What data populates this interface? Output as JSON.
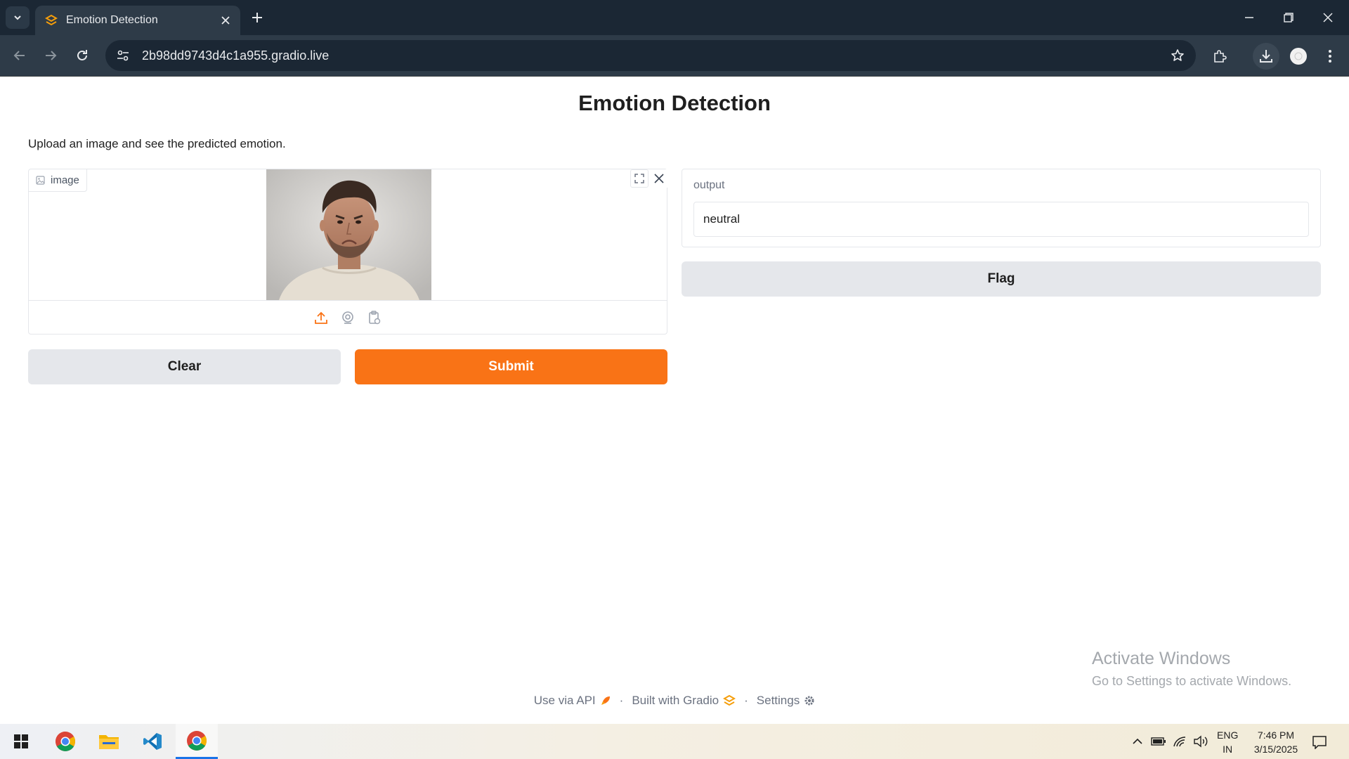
{
  "browser": {
    "tab_title": "Emotion Detection",
    "url": "2b98dd9743d4c1a955.gradio.live"
  },
  "app": {
    "title": "Emotion Detection",
    "description": "Upload an image and see the predicted emotion.",
    "input": {
      "label": "image",
      "sources": [
        "upload-icon",
        "webcam-icon",
        "clipboard-icon"
      ]
    },
    "buttons": {
      "clear": "Clear",
      "submit": "Submit",
      "flag": "Flag"
    },
    "output": {
      "label": "output",
      "value": "neutral"
    },
    "accent_color": "#f97316"
  },
  "footer": {
    "api": "Use via API",
    "built_with": "Built with Gradio",
    "settings": "Settings"
  },
  "watermark": {
    "title": "Activate Windows",
    "subtitle": "Go to Settings to activate Windows."
  },
  "taskbar": {
    "apps": [
      "windows-start-icon",
      "chrome-icon",
      "file-explorer-icon",
      "vscode-icon",
      "chrome-active-icon"
    ],
    "lang_line1": "ENG",
    "lang_line2": "IN",
    "time": "7:46 PM",
    "date": "3/15/2025"
  }
}
